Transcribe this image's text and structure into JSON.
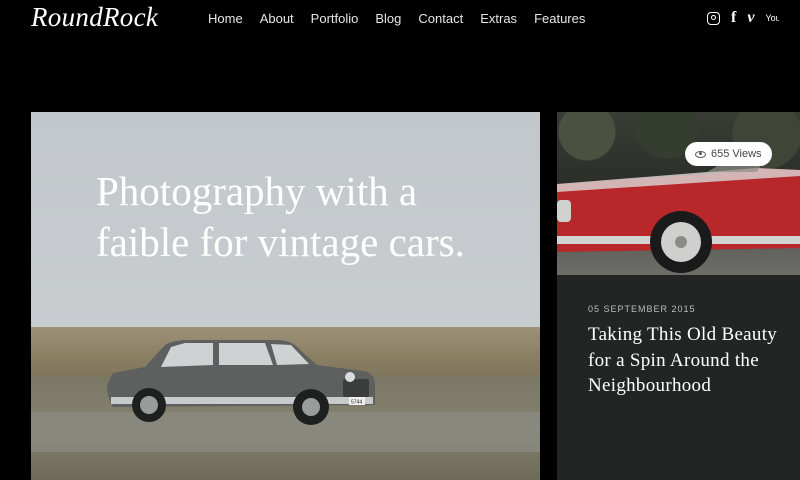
{
  "site": {
    "logo": "RoundRock"
  },
  "nav": {
    "items": [
      "Home",
      "About",
      "Portfolio",
      "Blog",
      "Contact",
      "Extras",
      "Features"
    ]
  },
  "social": {
    "icons": [
      "instagram-icon",
      "facebook-icon",
      "vimeo-icon",
      "youtube-icon"
    ],
    "facebook_glyph": "f",
    "vimeo_glyph": "v",
    "youtube_glyph": "You"
  },
  "hero": {
    "headline": "Photography with a faible for vintage cars.",
    "license_plate": "5744"
  },
  "featured_post": {
    "views": "655 Views",
    "date": "05 SEPTEMBER 2015",
    "title": "Taking This Old Beauty for a Spin Around the Neighbourhood"
  },
  "colors": {
    "background": "#000000",
    "side_card": "#232525",
    "red_car": "#b8272a",
    "grey_car": "#5d605f"
  }
}
